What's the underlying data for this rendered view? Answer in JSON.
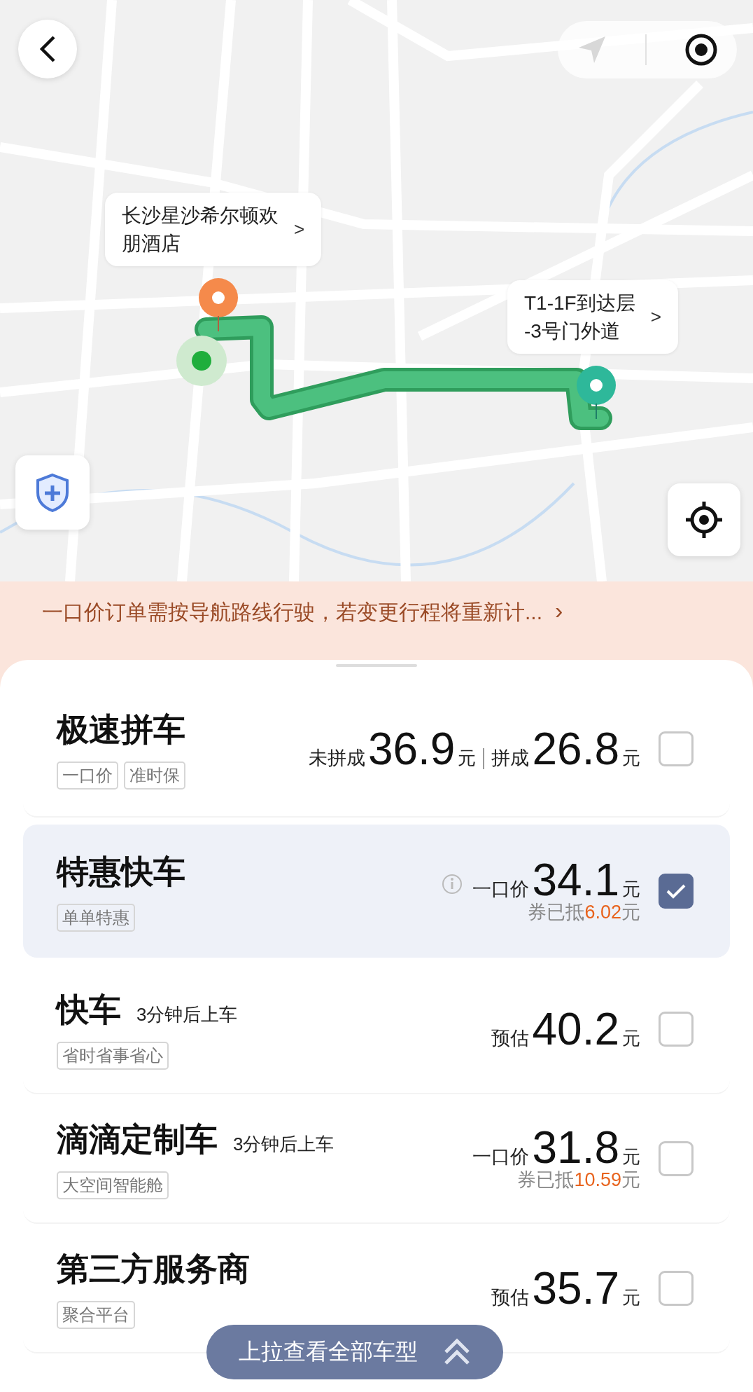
{
  "map": {
    "kind": "picture",
    "callouts": [
      {
        "lines": [
          "长沙星沙希尔顿欢",
          "朋酒店"
        ],
        "arrow": ">"
      },
      {
        "lines": [
          "T1-1F到达层",
          "-3号门外道"
        ],
        "arrow": ">"
      }
    ]
  },
  "notice": {
    "text": "一口价订单需按导航路线行驶，若变更行程将重新计...",
    "arrow": "›"
  },
  "rides": [
    {
      "name": "极速拼车",
      "tags": [
        "一口价",
        "准时保"
      ],
      "info": false,
      "selected": false,
      "prices": [
        {
          "prefix": "未拼成",
          "amount": "36.9",
          "unit": "元"
        },
        {
          "prefix": "拼成",
          "amount": "26.8",
          "unit": "元"
        }
      ]
    },
    {
      "name": "特惠快车",
      "tags": [
        "单单特惠"
      ],
      "info": true,
      "selected": true,
      "prices": [
        {
          "prefix": "一口价",
          "amount": "34.1",
          "unit": "元"
        }
      ],
      "discount": {
        "label": "券已抵",
        "amount": "6.02",
        "unit": "元"
      }
    },
    {
      "name": "快车",
      "eta": "3分钟后上车",
      "tags": [
        "省时省事省心"
      ],
      "info": false,
      "selected": false,
      "prices": [
        {
          "prefix": "预估",
          "amount": "40.2",
          "unit": "元"
        }
      ]
    },
    {
      "name": "滴滴定制车",
      "eta": "3分钟后上车",
      "tags": [
        "大空间智能舱"
      ],
      "info": false,
      "selected": false,
      "prices": [
        {
          "prefix": "一口价",
          "amount": "31.8",
          "unit": "元"
        }
      ],
      "discount": {
        "label": "券已抵",
        "amount": "10.59",
        "unit": "元"
      }
    },
    {
      "name": "第三方服务商",
      "tags": [
        "聚合平台"
      ],
      "info": false,
      "selected": false,
      "prices": [
        {
          "prefix": "预估",
          "amount": "35.7",
          "unit": "元"
        }
      ]
    }
  ],
  "pull_button": {
    "label": "上拉查看全部车型"
  }
}
